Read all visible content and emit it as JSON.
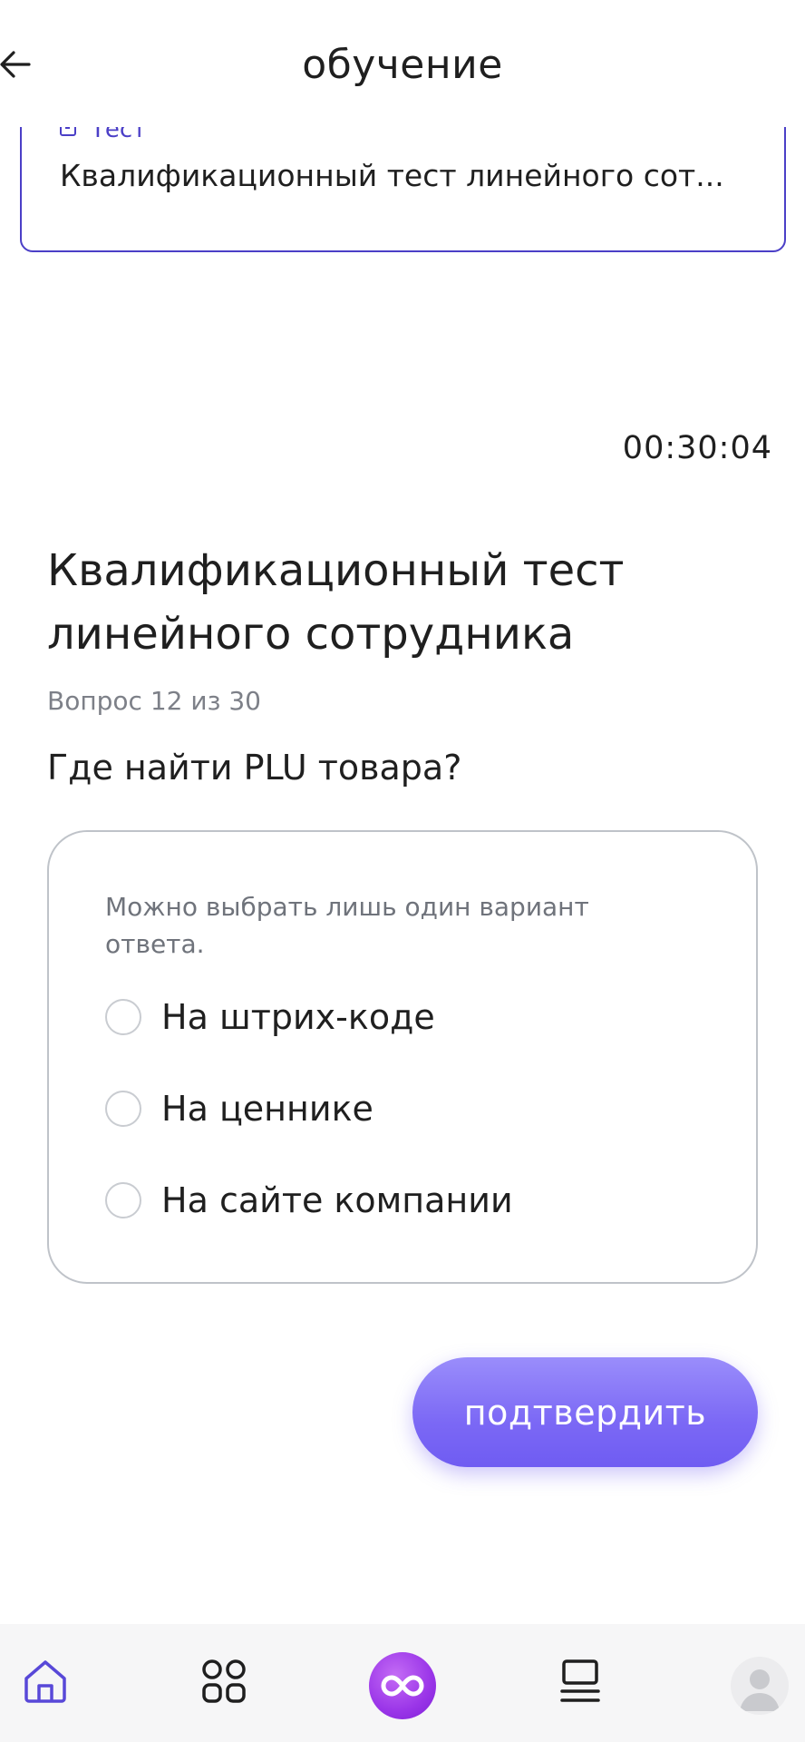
{
  "header": {
    "title": "обучение"
  },
  "card": {
    "label": "Тест",
    "text": "Квалификационный тест линейного сот..."
  },
  "timer": "00:30:04",
  "test": {
    "title": "Квалификационный тест линейного сотрудника",
    "question_count": "Вопрос 12 из 30",
    "question": "Где найти PLU товара?"
  },
  "answers": {
    "hint": "Можно выбрать лишь один вариант ответа.",
    "options": [
      {
        "label": "На штрих-коде",
        "selected": false
      },
      {
        "label": "На ценнике",
        "selected": false
      },
      {
        "label": "На сайте компании",
        "selected": false
      }
    ]
  },
  "confirm_label": "подтвердить",
  "tabbar": {
    "items": [
      {
        "icon": "home-icon",
        "active": true
      },
      {
        "icon": "grid-icon",
        "active": false
      },
      {
        "icon": "infinity-icon",
        "active": false
      },
      {
        "icon": "courses-icon",
        "active": false
      },
      {
        "icon": "profile-avatar",
        "active": false
      }
    ]
  },
  "colors": {
    "accent": "#4b3fc7",
    "button": "#7b68f5",
    "center": "#9a35e8"
  }
}
